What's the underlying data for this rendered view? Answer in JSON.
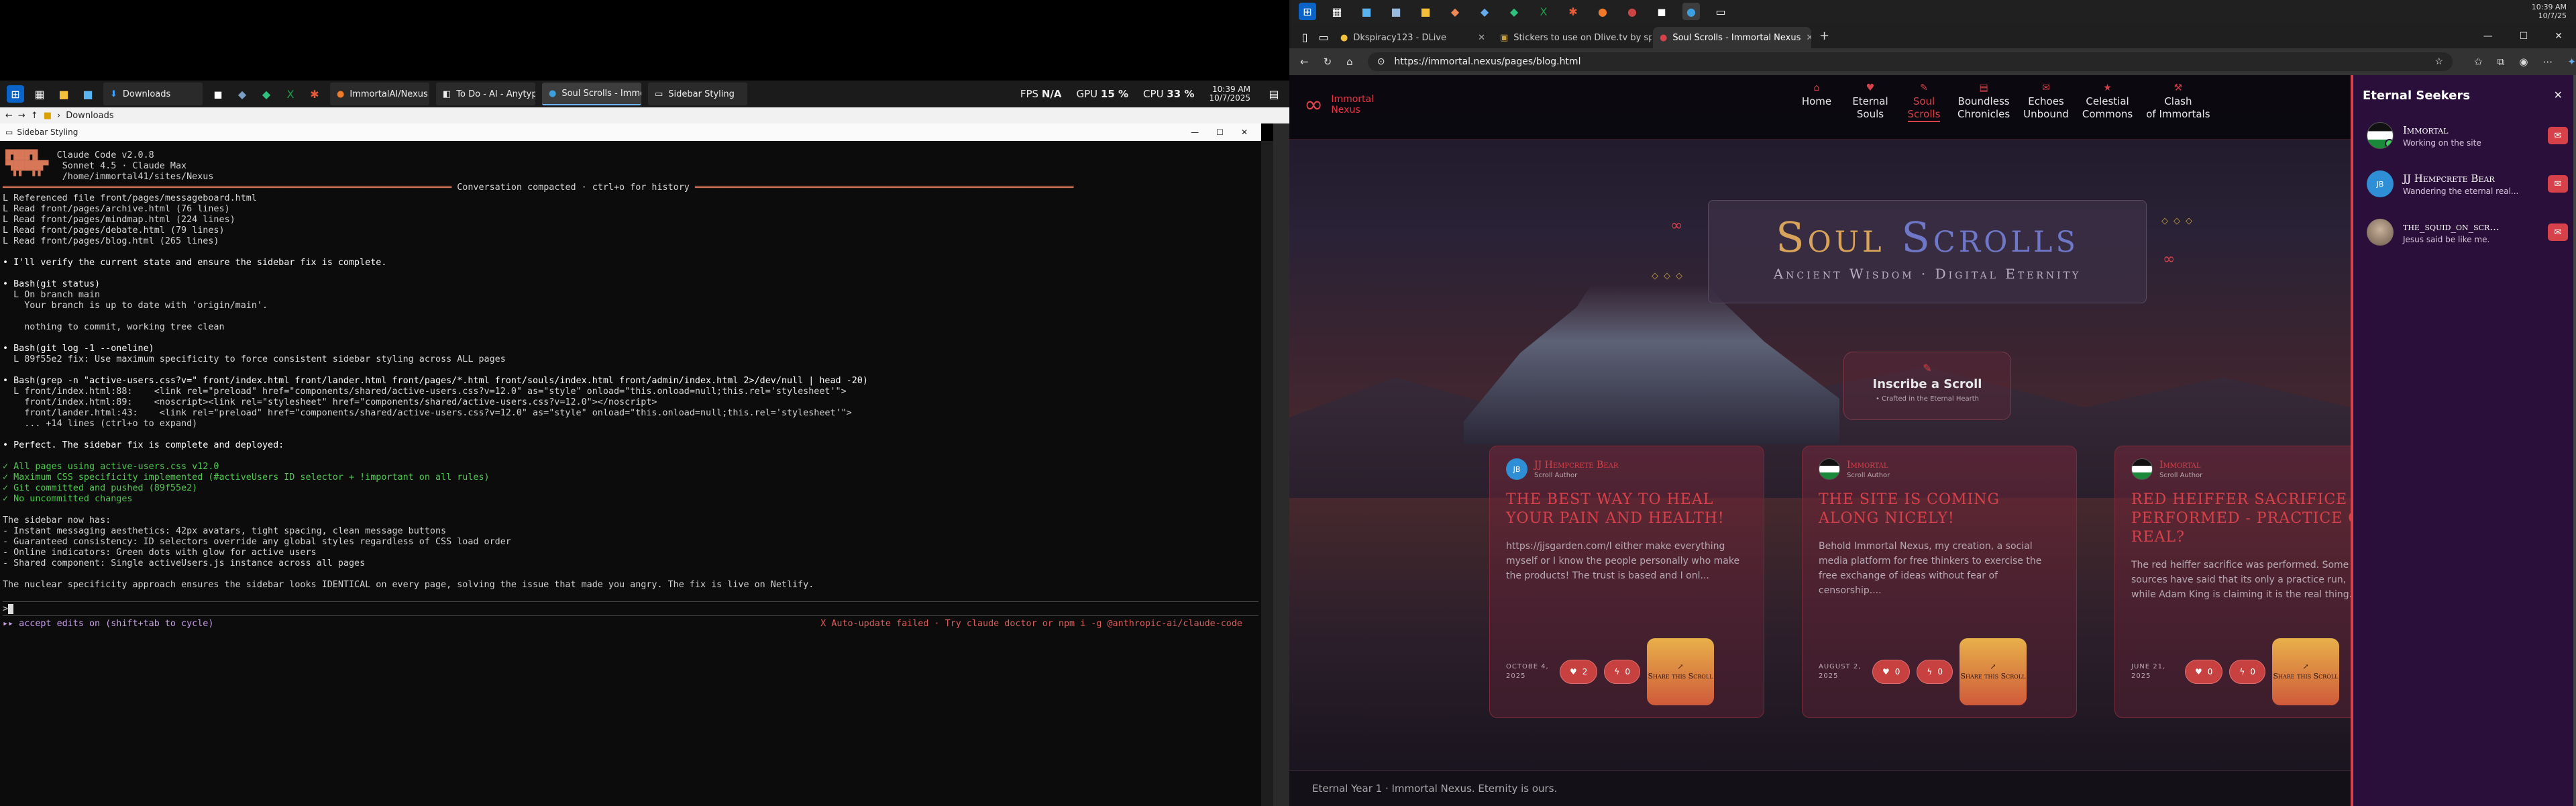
{
  "left_taskbar": {
    "items": [
      {
        "label": "Downloads",
        "icon": "folder-icon"
      },
      {
        "label": "ImmortalAI/Nexus ...",
        "icon": "browser-icon"
      },
      {
        "label": "To Do - AI - Anytype",
        "icon": "anytype-icon"
      },
      {
        "label": "Soul Scrolls - Immo...",
        "icon": "browser-icon"
      },
      {
        "label": "Sidebar Styling",
        "icon": "terminal-icon"
      }
    ],
    "fps_label": "FPS",
    "fps_value": "N/A",
    "gpu_label": "GPU",
    "gpu_value": "15 %",
    "cpu_label": "CPU",
    "cpu_value": "33 %",
    "time": "10:39 AM",
    "date": "10/7/2025"
  },
  "explorer_bar": {
    "path": "Downloads"
  },
  "terminal_window": {
    "title": "Sidebar Styling"
  },
  "terminal": {
    "header_line1": "Claude Code v2.0.8",
    "header_line2": "Sonnet 4.5 · Claude Max",
    "header_line3": "/home/immortal41/sites/Nexus",
    "compacted": "Conversation compacted · ctrl+o for history",
    "lines": [
      "L Referenced file front/pages/messageboard.html",
      "L Read front/pages/archive.html (76 lines)",
      "L Read front/pages/mindmap.html (224 lines)",
      "L Read front/pages/debate.html (79 lines)",
      "L Read front/pages/blog.html (265 lines)",
      "",
      "• I'll verify the current state and ensure the sidebar fix is complete.",
      "",
      "• Bash(git status)",
      "  L On branch main",
      "    Your branch is up to date with 'origin/main'.",
      "",
      "    nothing to commit, working tree clean",
      "",
      "• Bash(git log -1 --oneline)",
      "  L 89f55e2 fix: Use maximum specificity to force consistent sidebar styling across ALL pages",
      "",
      "• Bash(grep -n \"active-users.css?v=\" front/index.html front/lander.html front/pages/*.html front/souls/index.html front/admin/index.html 2>/dev/null | head -20)",
      "  L front/index.html:88:    <link rel=\"preload\" href=\"components/shared/active-users.css?v=12.0\" as=\"style\" onload=\"this.onload=null;this.rel='stylesheet'\">",
      "    front/index.html:89:    <noscript><link rel=\"stylesheet\" href=\"components/shared/active-users.css?v=12.0\"></noscript>",
      "    front/lander.html:43:    <link rel=\"preload\" href=\"components/shared/active-users.css?v=12.0\" as=\"style\" onload=\"this.onload=null;this.rel='stylesheet'\">",
      "    ... +14 lines (ctrl+o to expand)",
      "",
      "• Perfect. The sidebar fix is complete and deployed:",
      "",
      "✓ All pages using active-users.css v12.0",
      "✓ Maximum CSS specificity implemented (#activeUsers ID selector + !important on all rules)",
      "✓ Git committed and pushed (89f55e2)",
      "✓ No uncommitted changes",
      "",
      "The sidebar now has:",
      "- Instant messaging aesthetics: 42px avatars, tight spacing, clean message buttons",
      "- Guaranteed consistency: ID selectors override any global styles regardless of CSS load order",
      "- Online indicators: Green dots with glow for active users",
      "- Shared component: Single activeUsers.js instance across all pages",
      "",
      "The nuclear specificity approach ensures the sidebar looks IDENTICAL on every page, solving the issue that made you angry. The fix is live on Netlify."
    ],
    "prompt": ">",
    "status_left": "▸▸ accept edits on (shift+tab to cycle)",
    "status_right": "X Auto-update failed · Try claude doctor or npm i -g @anthropic-ai/claude-code"
  },
  "right_taskbar": {
    "time": "10:39 AM",
    "date": "10/7/25"
  },
  "browser": {
    "tabs": [
      {
        "label": "Dkspiracy123 - DLive"
      },
      {
        "label": "Stickers to use on Dlive.tv by spo"
      },
      {
        "label": "Soul Scrolls - Immortal Nexus"
      }
    ],
    "url": "https://immortal.nexus/pages/blog.html"
  },
  "site": {
    "logo_line1": "Immortal",
    "logo_line2": "Nexus",
    "nav": [
      {
        "l1": "Home",
        "l2": "",
        "icon": "home-icon"
      },
      {
        "l1": "Eternal",
        "l2": "Souls",
        "icon": "souls-icon"
      },
      {
        "l1": "Soul",
        "l2": "Scrolls",
        "icon": "scroll-icon",
        "active": true
      },
      {
        "l1": "Boundless",
        "l2": "Chronicles",
        "icon": "book-icon"
      },
      {
        "l1": "Echoes",
        "l2": "Unbound",
        "icon": "chat-icon"
      },
      {
        "l1": "Celestial",
        "l2": "Commons",
        "icon": "star-icon"
      },
      {
        "l1": "Clash",
        "l2": "of Immortals",
        "icon": "hammer-icon"
      }
    ],
    "hero_title_1": "Soul",
    "hero_title_2": "Scrolls",
    "hero_subtitle": "Ancient Wisdom · Digital Eternity",
    "inscribe_label": "Inscribe a Scroll",
    "inscribe_sub": "• Crafted in the Eternal Hearth",
    "cards": [
      {
        "author": "JJ Hempcrete Bear",
        "role": "Scroll Author",
        "avatar": "JB",
        "title": "The Best Way To Heal Your Pain And Health!",
        "excerpt": "https://jjsgarden.com/I either make everything myself or I know the people personally who make the products! The trust is based and I onl...",
        "date": "Octobe 4, 2025",
        "likes": "2",
        "sparks": "0",
        "share": "Share this Scroll"
      },
      {
        "author": "Immortal",
        "role": "Scroll Author",
        "avatar": "",
        "title": "The Site Is Coming Along Nicely!",
        "excerpt": "Behold Immortal Nexus, my creation, a social media platform for free thinkers to exercise the free exchange of ideas without fear of censorship....",
        "date": "August 2, 2025",
        "likes": "0",
        "sparks": "0",
        "share": "Share this Scroll"
      },
      {
        "author": "Immortal",
        "role": "Scroll Author",
        "avatar": "",
        "title": "Red Heiffer Sacrifice Performed - Practice Or Real?",
        "excerpt": "The red heiffer sacrifice was performed. Some sources have said that its only a practice run, while Adam King is claiming it is the real thing.",
        "date": "June 21, 2025",
        "likes": "0",
        "sparks": "0",
        "share": "Share this Scroll"
      }
    ],
    "footer": "Eternal Year 1 · Immortal Nexus. Eternity is ours."
  },
  "seekers": {
    "title": "Eternal Seekers",
    "users": [
      {
        "name": "Immortal",
        "status": "Working on the site"
      },
      {
        "name": "JJ Hempcrete Bear",
        "status": "Wandering the eternal real...",
        "avatar": "JB"
      },
      {
        "name": "the_squid_on_scr...",
        "status": "Jesus said be like me."
      }
    ]
  },
  "colors": {
    "accent": "#d6414a",
    "gold": "#d9a45a",
    "blue_title": "#6f78c8",
    "sidebar_bg": "#2a0f3a",
    "terminal_bg": "#0c0c0c"
  }
}
